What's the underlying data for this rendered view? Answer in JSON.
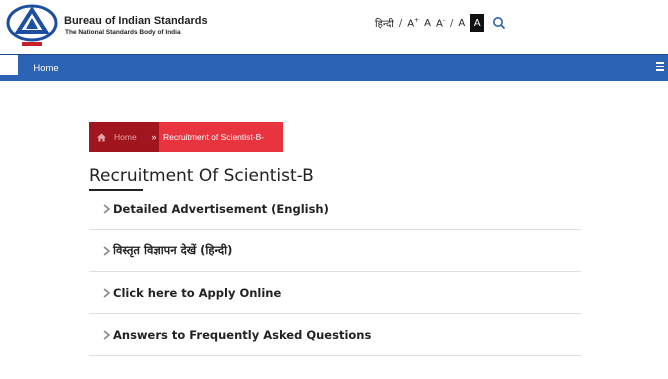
{
  "header": {
    "org_name": "Bureau of Indian Standards",
    "org_tagline": "The National Standards Body of India",
    "logo_icon": "bis-logo-icon",
    "language_link": "हिन्दी",
    "font_increase": "A",
    "font_normal": "A",
    "font_decrease": "A",
    "contrast_normal": "A",
    "contrast_dark": "A",
    "search_icon": "search-icon"
  },
  "nav": {
    "home_label": "Home",
    "menu_icon": "hamburger-icon"
  },
  "breadcrumb": {
    "home_label": "Home",
    "separator": "»",
    "current_label": "Recruitment of Scientist-B-"
  },
  "page": {
    "title": "Recruitment Of Scientist-B"
  },
  "links": [
    {
      "label": "Detailed Advertisement (English)"
    },
    {
      "label": "विस्तृत विज्ञापन देखें (हिन्दी)"
    },
    {
      "label": "Click here to Apply Online"
    },
    {
      "label": "Answers to Frequently Asked Questions"
    }
  ],
  "colors": {
    "nav_blue": "#2c63b5",
    "crumb_dark_red": "#a0151e",
    "crumb_red": "#e8343f"
  }
}
